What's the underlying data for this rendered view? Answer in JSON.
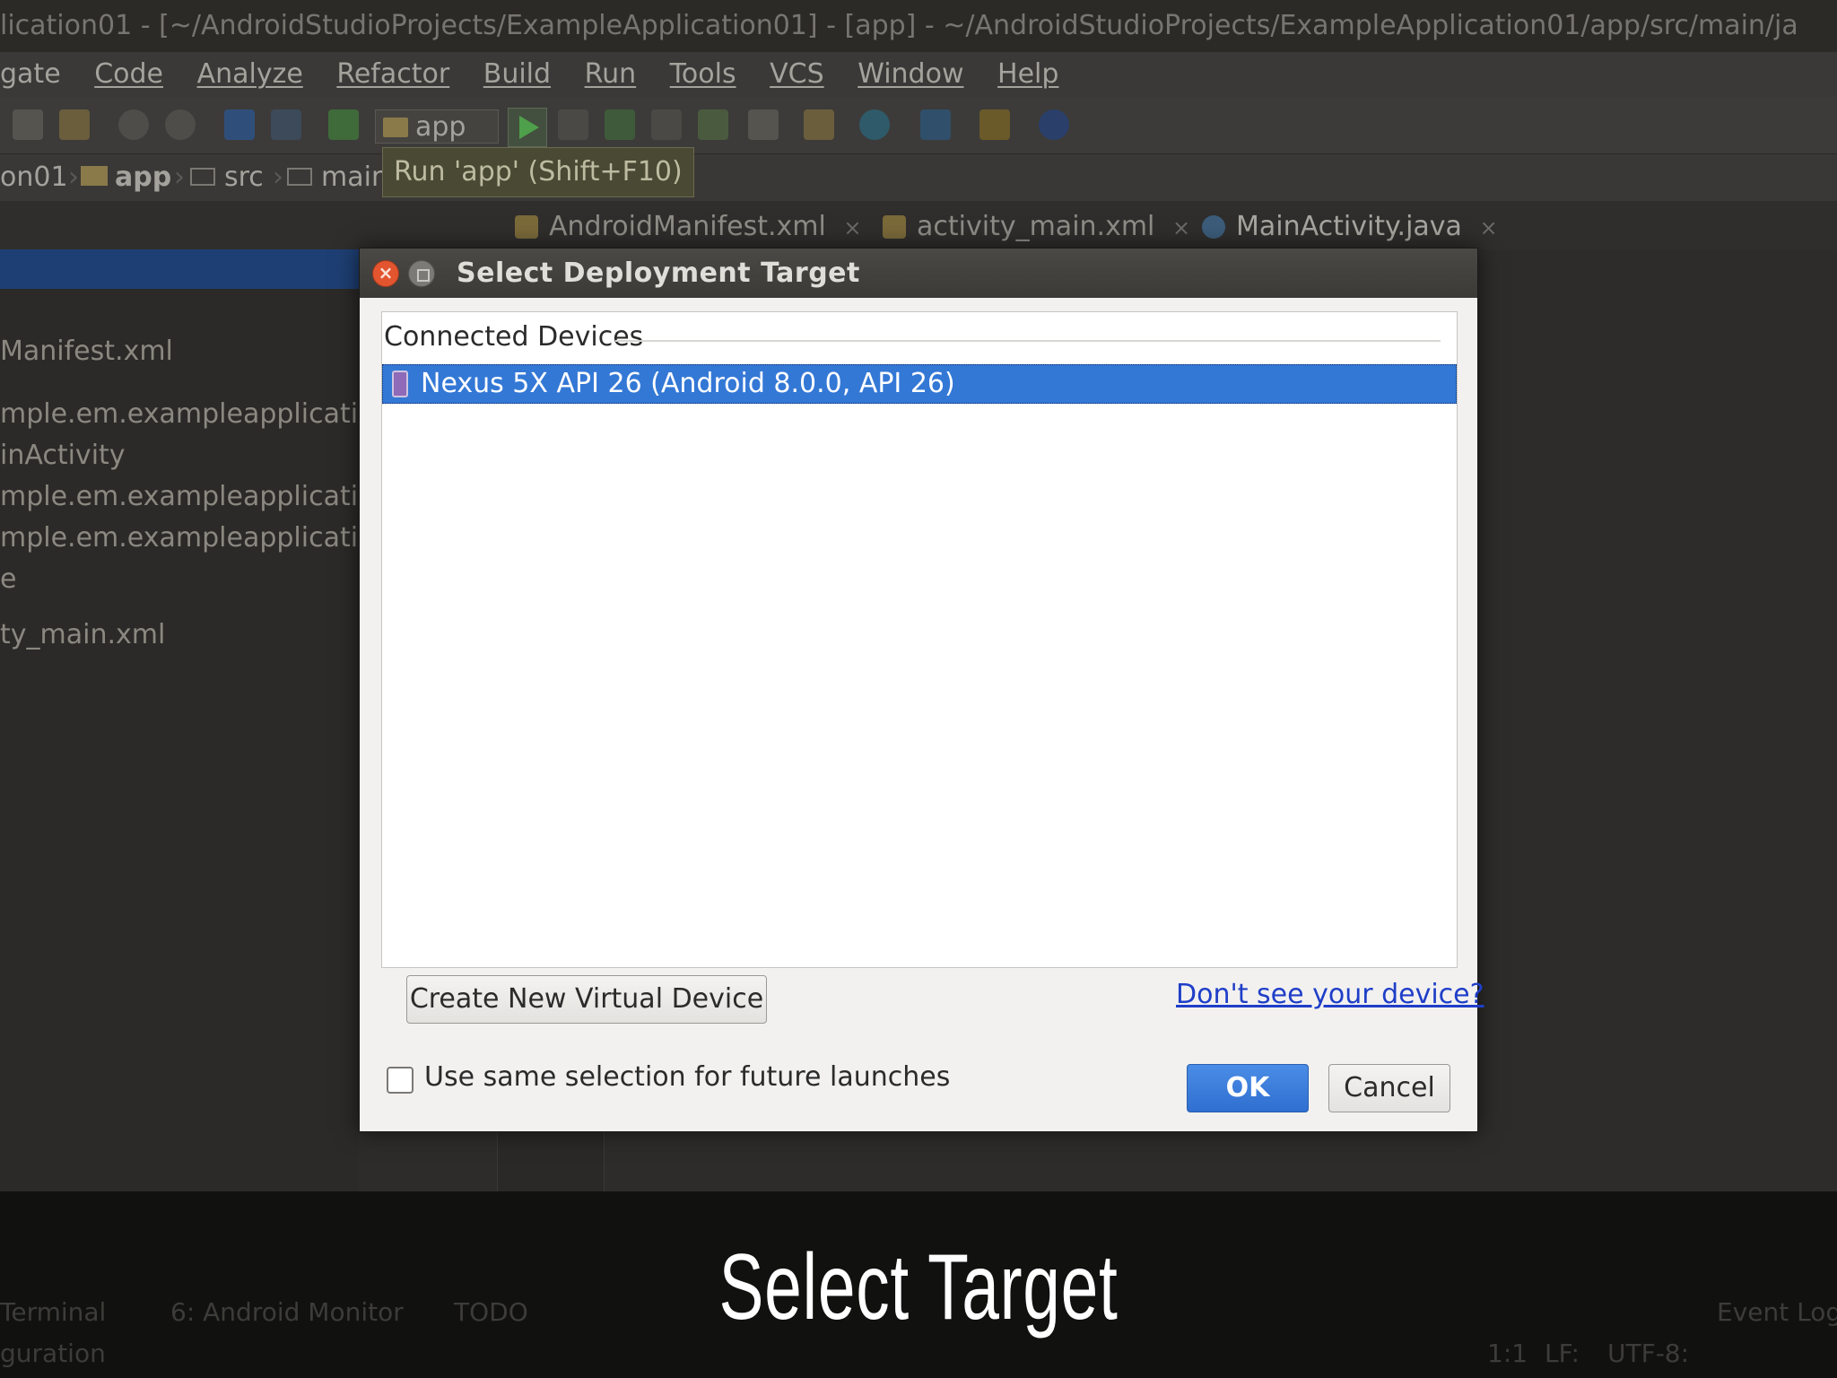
{
  "window": {
    "title": "lication01 - [~/AndroidStudioProjects/ExampleApplication01] - [app] - ~/AndroidStudioProjects/ExampleApplication01/app/src/main/ja"
  },
  "menu": {
    "items": [
      "gate",
      "Code",
      "Analyze",
      "Refactor",
      "Build",
      "Run",
      "Tools",
      "VCS",
      "Window",
      "Help"
    ]
  },
  "toolbar": {
    "run_config": "app",
    "run_tooltip": "Run 'app' (Shift+F10)"
  },
  "breadcrumb": {
    "items": [
      "on01",
      "app",
      "src",
      "main"
    ]
  },
  "editor_tabs": [
    {
      "label": "AndroidManifest.xml",
      "active": false
    },
    {
      "label": "activity_main.xml",
      "active": false
    },
    {
      "label": "MainActivity.java",
      "active": true
    }
  ],
  "project_tree": {
    "lines": [
      "Manifest.xml",
      "mple.em.exampleapplicatio",
      "inActivity",
      "mple.em.exampleapplicatio",
      "mple.em.exampleapplicatio",
      "e",
      "ty_main.xml"
    ]
  },
  "bottom_tools": {
    "items": [
      "Terminal",
      "6: Android Monitor",
      "TODO",
      "Event Log"
    ],
    "status_left": "guration",
    "status_right": [
      "1:1",
      "LF:",
      "UTF-8:"
    ]
  },
  "dialog": {
    "title": "Select Deployment Target",
    "section_label": "Connected Devices",
    "devices": [
      {
        "name": "Nexus 5X API 26 (Android 8.0.0, API 26)",
        "selected": true
      }
    ],
    "create_button": "Create New Virtual Device",
    "help_link": "Don't see your device?",
    "checkbox_label": "Use same selection for future launches",
    "checkbox_checked": false,
    "ok_button": "OK",
    "cancel_button": "Cancel"
  },
  "caption": "Select Target",
  "colors": {
    "selection": "#3478d6",
    "ok_button": "#2f6fd0",
    "link": "#1f3ec8",
    "close_button": "#e3552f"
  }
}
